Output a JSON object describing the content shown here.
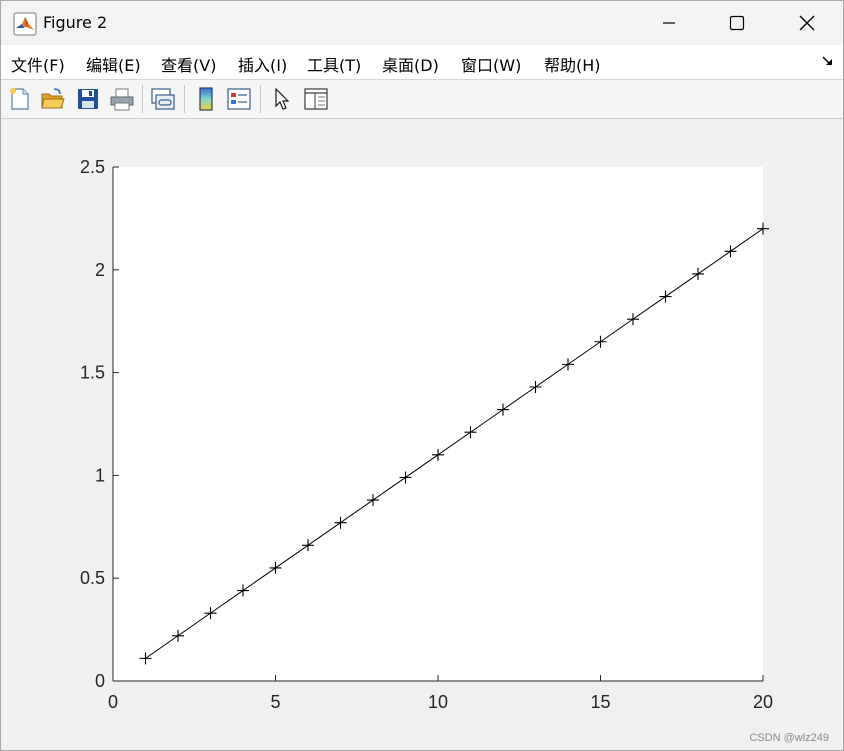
{
  "window": {
    "title": "Figure 2",
    "icon": "matlab-logo-icon",
    "controls": [
      "minimize-icon",
      "maximize-icon",
      "close-icon"
    ]
  },
  "menu": {
    "items": [
      {
        "label": "文件(F)"
      },
      {
        "label": "编辑(E)"
      },
      {
        "label": "查看(V)"
      },
      {
        "label": "插入(I)"
      },
      {
        "label": "工具(T)"
      },
      {
        "label": "桌面(D)"
      },
      {
        "label": "窗口(W)"
      },
      {
        "label": "帮助(H)"
      }
    ],
    "dock_icon": "dock-arrow-icon"
  },
  "toolbar": {
    "tools": [
      "new-figure-icon",
      "open-file-icon",
      "save-icon",
      "print-icon",
      "link-plot-icon",
      "insert-colorbar-icon",
      "insert-legend-icon",
      "edit-plot-pointer-icon",
      "property-inspector-icon"
    ]
  },
  "chart_data": {
    "type": "line",
    "title": "",
    "xlabel": "",
    "ylabel": "",
    "xlim": [
      0,
      20
    ],
    "ylim": [
      0,
      2.5
    ],
    "xticks": [
      "0",
      "5",
      "10",
      "15",
      "20"
    ],
    "yticks": [
      "0",
      "0.5",
      "1",
      "1.5",
      "2",
      "2.5"
    ],
    "xtick_values": [
      0,
      5,
      10,
      15,
      20
    ],
    "ytick_values": [
      0,
      0.5,
      1,
      1.5,
      2,
      2.5
    ],
    "grid": false,
    "series": [
      {
        "marker": "+",
        "color": "#000000",
        "x": [
          1,
          2,
          3,
          4,
          5,
          6,
          7,
          8,
          9,
          10,
          11,
          12,
          13,
          14,
          15,
          16,
          17,
          18,
          19,
          20
        ],
        "values": [
          0.11,
          0.22,
          0.33,
          0.44,
          0.55,
          0.66,
          0.77,
          0.88,
          0.99,
          1.1,
          1.21,
          1.32,
          1.43,
          1.54,
          1.65,
          1.76,
          1.87,
          1.98,
          2.09,
          2.2
        ]
      }
    ]
  },
  "watermark": "CSDN @wlz249"
}
